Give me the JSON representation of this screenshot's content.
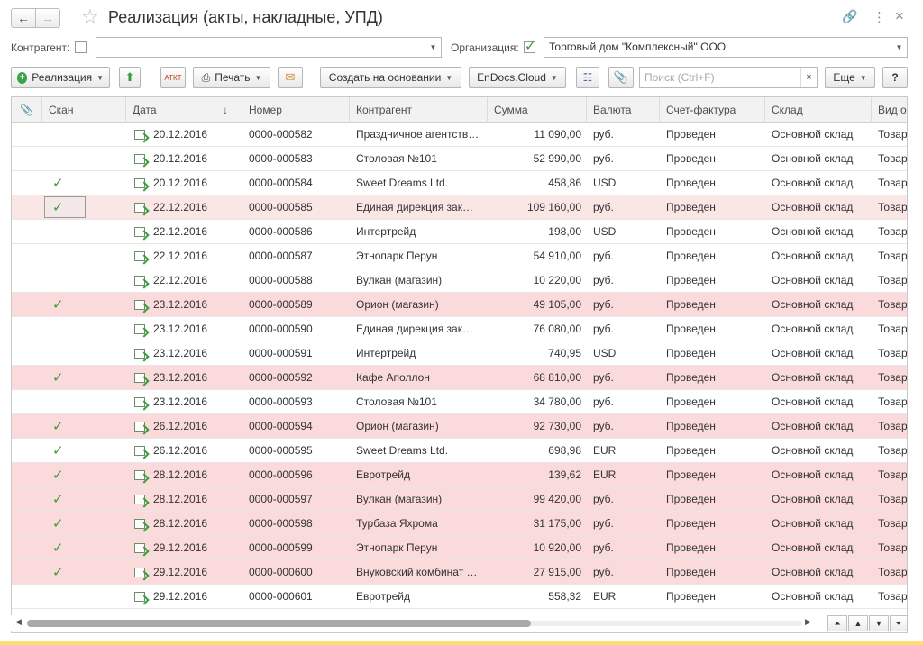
{
  "window": {
    "title": "Реализация (акты, накладные, УПД)",
    "back_icon": "←",
    "forward_icon": "→",
    "star_icon": "☆",
    "link_icon": "🔗",
    "menu_icon": "⋮",
    "close_icon": "×"
  },
  "filters": {
    "contractor_label": "Контрагент:",
    "contractor_value": "",
    "contractor_checked": false,
    "org_label": "Организация:",
    "org_checked": true,
    "org_value": "Торговый дом \"Комплексный\" ООО"
  },
  "toolbar": {
    "create_label": "Реализация",
    "print_label": "Печать",
    "create_based_label": "Создать на основании",
    "endocs_label": "EnDocs.Cloud",
    "search_placeholder": "Поиск (Ctrl+F)",
    "more_label": "Еще",
    "help_label": "?",
    "atkt_label": "АТКТ"
  },
  "columns": [
    "Скан",
    "Дата",
    "Номер",
    "Контрагент",
    "Сумма",
    "Валюта",
    "Счет-фактура",
    "Склад",
    "Вид о"
  ],
  "sort_indicator": "↓",
  "rows": [
    {
      "scan": false,
      "date": "20.12.2016",
      "num": "0000-000582",
      "contractor": "Праздничное агентств…",
      "sum": "11 090,00",
      "cur": "руб.",
      "invoice": "Проведен",
      "stock": "Основной склад",
      "kind": "Товар",
      "style": ""
    },
    {
      "scan": false,
      "date": "20.12.2016",
      "num": "0000-000583",
      "contractor": "Столовая №101",
      "sum": "52 990,00",
      "cur": "руб.",
      "invoice": "Проведен",
      "stock": "Основной склад",
      "kind": "Товар",
      "style": ""
    },
    {
      "scan": true,
      "date": "20.12.2016",
      "num": "0000-000584",
      "contractor": "Sweet Dreams Ltd.",
      "sum": "458,86",
      "cur": "USD",
      "invoice": "Проведен",
      "stock": "Основной склад",
      "kind": "Товар",
      "style": ""
    },
    {
      "scan": true,
      "date": "22.12.2016",
      "num": "0000-000585",
      "contractor": "Единая дирекция зак…",
      "sum": "109 160,00",
      "cur": "руб.",
      "invoice": "Проведен",
      "stock": "Основной склад",
      "kind": "Товар",
      "style": "sel"
    },
    {
      "scan": false,
      "date": "22.12.2016",
      "num": "0000-000586",
      "contractor": "Интертрейд",
      "sum": "198,00",
      "cur": "USD",
      "invoice": "Проведен",
      "stock": "Основной склад",
      "kind": "Товар",
      "style": ""
    },
    {
      "scan": false,
      "date": "22.12.2016",
      "num": "0000-000587",
      "contractor": "Этнопарк Перун",
      "sum": "54 910,00",
      "cur": "руб.",
      "invoice": "Проведен",
      "stock": "Основной склад",
      "kind": "Товар",
      "style": ""
    },
    {
      "scan": false,
      "date": "22.12.2016",
      "num": "0000-000588",
      "contractor": "Вулкан (магазин)",
      "sum": "10 220,00",
      "cur": "руб.",
      "invoice": "Проведен",
      "stock": "Основной склад",
      "kind": "Товар",
      "style": ""
    },
    {
      "scan": true,
      "date": "23.12.2016",
      "num": "0000-000589",
      "contractor": "Орион (магазин)",
      "sum": "49 105,00",
      "cur": "руб.",
      "invoice": "Проведен",
      "stock": "Основной склад",
      "kind": "Товар",
      "style": "pink"
    },
    {
      "scan": false,
      "date": "23.12.2016",
      "num": "0000-000590",
      "contractor": "Единая дирекция зак…",
      "sum": "76 080,00",
      "cur": "руб.",
      "invoice": "Проведен",
      "stock": "Основной склад",
      "kind": "Товар",
      "style": ""
    },
    {
      "scan": false,
      "date": "23.12.2016",
      "num": "0000-000591",
      "contractor": "Интертрейд",
      "sum": "740,95",
      "cur": "USD",
      "invoice": "Проведен",
      "stock": "Основной склад",
      "kind": "Товар",
      "style": ""
    },
    {
      "scan": true,
      "date": "23.12.2016",
      "num": "0000-000592",
      "contractor": "Кафе Аполлон",
      "sum": "68 810,00",
      "cur": "руб.",
      "invoice": "Проведен",
      "stock": "Основной склад",
      "kind": "Товар",
      "style": "pink"
    },
    {
      "scan": false,
      "date": "23.12.2016",
      "num": "0000-000593",
      "contractor": "Столовая №101",
      "sum": "34 780,00",
      "cur": "руб.",
      "invoice": "Проведен",
      "stock": "Основной склад",
      "kind": "Товар",
      "style": ""
    },
    {
      "scan": true,
      "date": "26.12.2016",
      "num": "0000-000594",
      "contractor": "Орион (магазин)",
      "sum": "92 730,00",
      "cur": "руб.",
      "invoice": "Проведен",
      "stock": "Основной склад",
      "kind": "Товар",
      "style": "pink"
    },
    {
      "scan": true,
      "date": "26.12.2016",
      "num": "0000-000595",
      "contractor": "Sweet Dreams Ltd.",
      "sum": "698,98",
      "cur": "EUR",
      "invoice": "Проведен",
      "stock": "Основной склад",
      "kind": "Товар",
      "style": ""
    },
    {
      "scan": true,
      "date": "28.12.2016",
      "num": "0000-000596",
      "contractor": "Евротрейд",
      "sum": "139,62",
      "cur": "EUR",
      "invoice": "Проведен",
      "stock": "Основной склад",
      "kind": "Товар",
      "style": "pink"
    },
    {
      "scan": true,
      "date": "28.12.2016",
      "num": "0000-000597",
      "contractor": "Вулкан (магазин)",
      "sum": "99 420,00",
      "cur": "руб.",
      "invoice": "Проведен",
      "stock": "Основной склад",
      "kind": "Товар",
      "style": "pink"
    },
    {
      "scan": true,
      "date": "28.12.2016",
      "num": "0000-000598",
      "contractor": "Турбаза Яхрома",
      "sum": "31 175,00",
      "cur": "руб.",
      "invoice": "Проведен",
      "stock": "Основной склад",
      "kind": "Товар",
      "style": "pink"
    },
    {
      "scan": true,
      "date": "29.12.2016",
      "num": "0000-000599",
      "contractor": "Этнопарк Перун",
      "sum": "10 920,00",
      "cur": "руб.",
      "invoice": "Проведен",
      "stock": "Основной склад",
      "kind": "Товар",
      "style": "pink"
    },
    {
      "scan": true,
      "date": "29.12.2016",
      "num": "0000-000600",
      "contractor": "Внуковский комбинат …",
      "sum": "27 915,00",
      "cur": "руб.",
      "invoice": "Проведен",
      "stock": "Основной склад",
      "kind": "Товар",
      "style": "pink"
    },
    {
      "scan": false,
      "date": "29.12.2016",
      "num": "0000-000601",
      "contractor": "Евротрейд",
      "sum": "558,32",
      "cur": "EUR",
      "invoice": "Проведен",
      "stock": "Основной склад",
      "kind": "Товар",
      "style": ""
    }
  ],
  "scroll": {
    "horizontal_position_fraction": 0.0,
    "visible_fraction": 0.65
  },
  "colors": {
    "highlight_row": "#fadadb",
    "check_green": "#3a9d3c",
    "accent_yellow": "#ffde73"
  }
}
